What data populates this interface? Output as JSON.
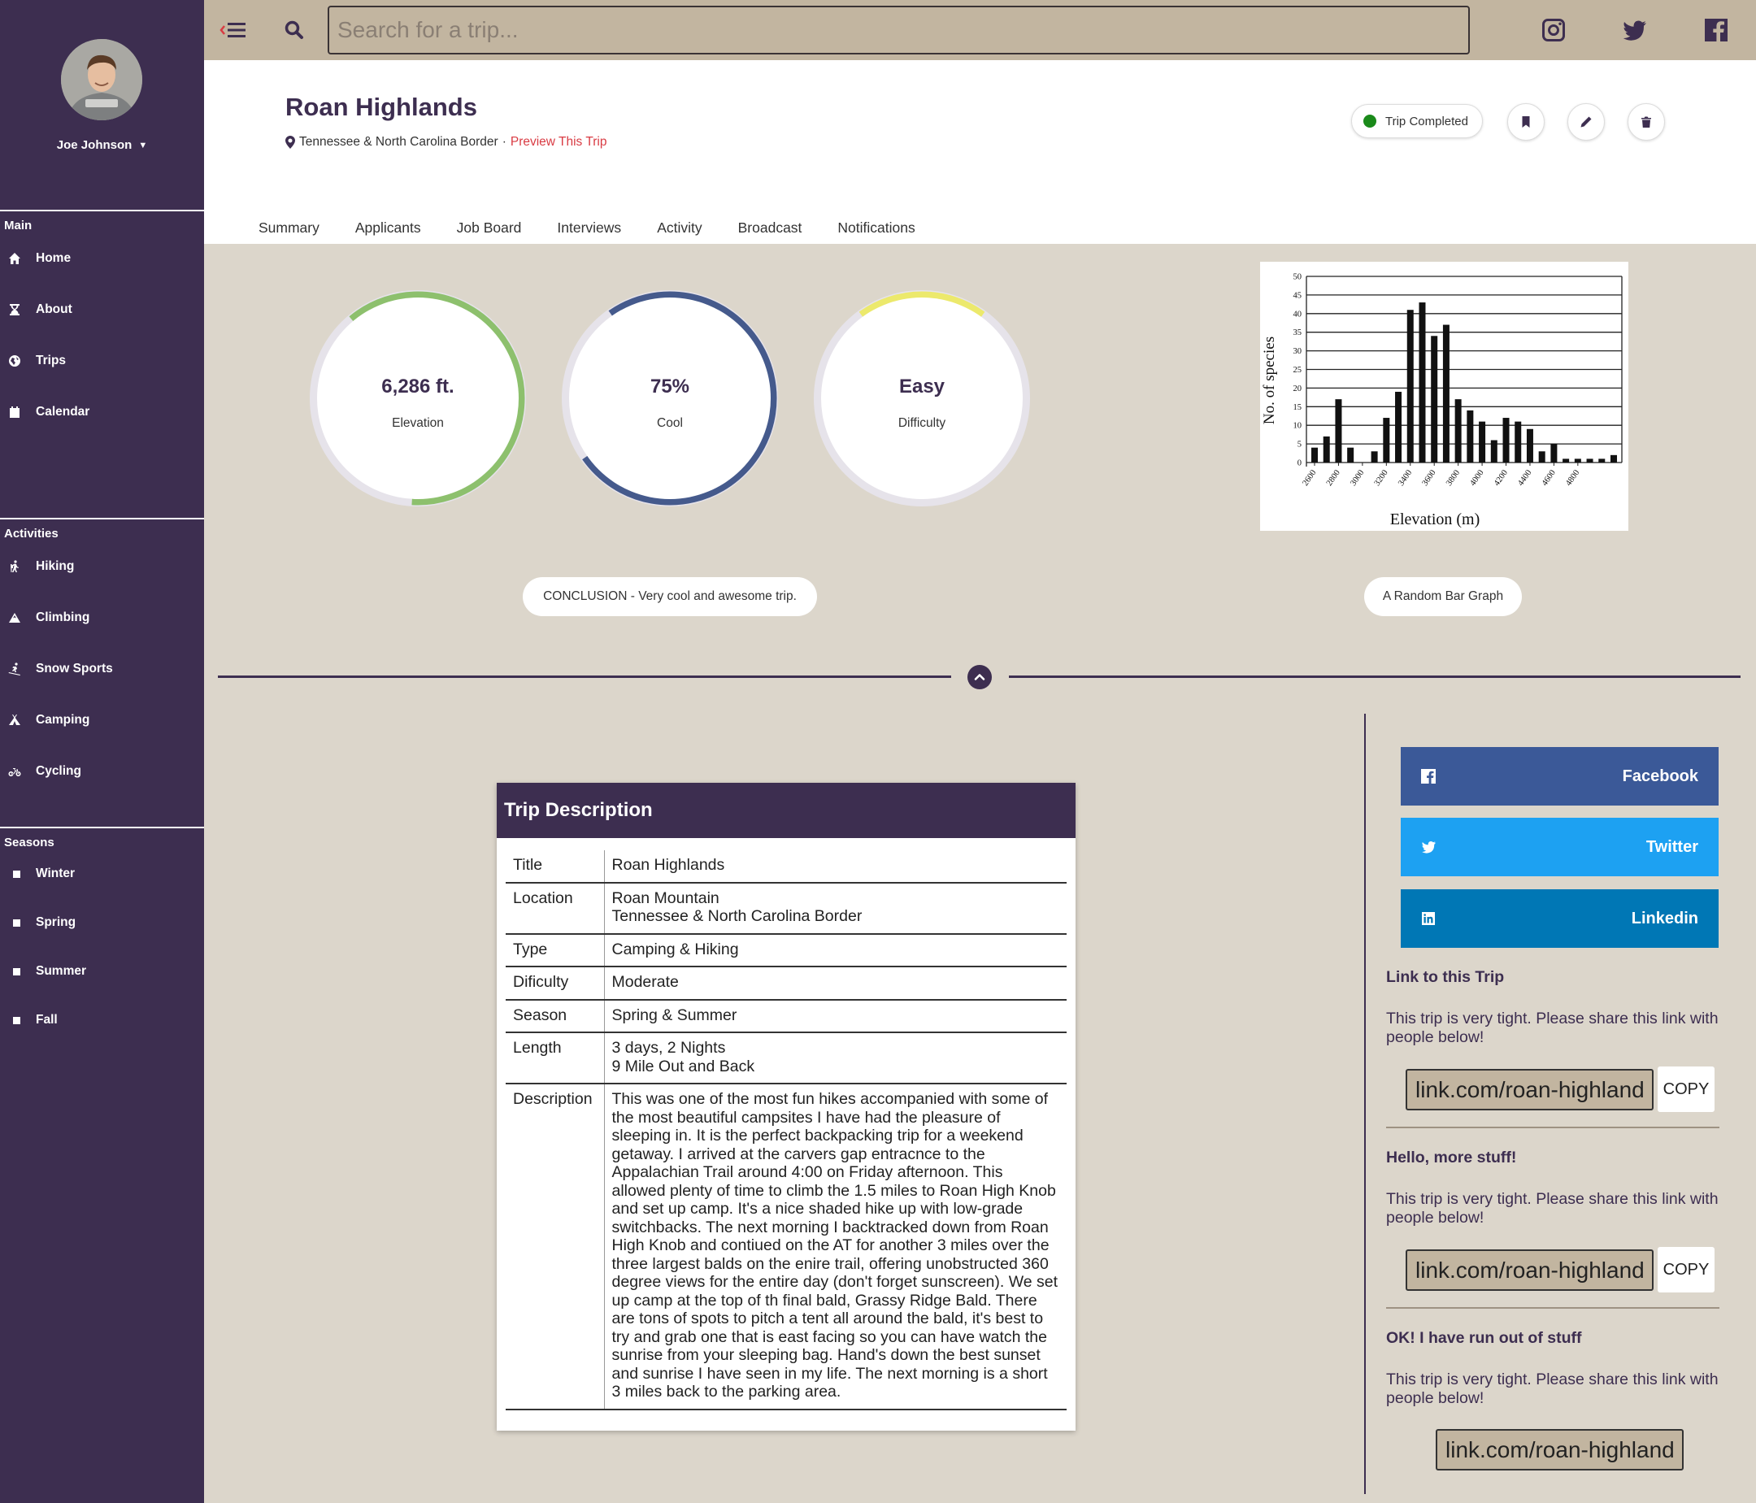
{
  "user": {
    "name": "Joe Johnson"
  },
  "sidebar": {
    "sections": [
      {
        "title": "Main",
        "items": [
          {
            "label": "Home",
            "icon": "home-icon"
          },
          {
            "label": "About",
            "icon": "hourglass-icon"
          },
          {
            "label": "Trips",
            "icon": "globe-icon"
          },
          {
            "label": "Calendar",
            "icon": "calendar-icon"
          }
        ]
      },
      {
        "title": "Activities",
        "items": [
          {
            "label": "Hiking",
            "icon": "hiking-icon"
          },
          {
            "label": "Climbing",
            "icon": "mountain-icon"
          },
          {
            "label": "Snow Sports",
            "icon": "skiing-icon"
          },
          {
            "label": "Camping",
            "icon": "tent-icon"
          },
          {
            "label": "Cycling",
            "icon": "bicycle-icon"
          }
        ]
      },
      {
        "title": "Seasons",
        "items": [
          {
            "label": "Winter",
            "icon": "square-bullet-icon"
          },
          {
            "label": "Spring",
            "icon": "square-bullet-icon"
          },
          {
            "label": "Summer",
            "icon": "square-bullet-icon"
          },
          {
            "label": "Fall",
            "icon": "square-bullet-icon"
          }
        ]
      }
    ]
  },
  "topbar": {
    "search_placeholder": "Search for a trip...",
    "social": [
      "instagram-icon",
      "twitter-icon",
      "facebook-icon"
    ]
  },
  "trip": {
    "title": "Roan Highlands",
    "location": "Tennessee & North Carolina Border",
    "separator": "·",
    "preview_link": "Preview This Trip",
    "status": "Trip Completed",
    "status_color": "#1a8a1a"
  },
  "tabs": [
    "Summary",
    "Applicants",
    "Job Board",
    "Interviews",
    "Activity",
    "Broadcast",
    "Notifications"
  ],
  "stats": [
    {
      "value": "6,286 ft.",
      "caption": "Elevation",
      "color": "#8dc06d",
      "progress": 0.62
    },
    {
      "value": "75%",
      "caption": "Cool",
      "color": "#455a8c",
      "progress": 0.75
    },
    {
      "value": "Easy",
      "caption": "Difficulty",
      "color": "#ece96c",
      "progress": 0.2
    }
  ],
  "conclusion": "CONCLUSION - Very cool and awesome trip.",
  "chart_caption": "A Random Bar Graph",
  "chart_data": {
    "type": "bar",
    "xlabel": "Elevation (m)",
    "ylabel": "No. of species",
    "ylim": [
      0,
      50
    ],
    "yticks": [
      0,
      5,
      10,
      15,
      20,
      25,
      30,
      35,
      40,
      45,
      50
    ],
    "xtick_labels": [
      "2600",
      "2800",
      "3000",
      "3200",
      "3400",
      "3600",
      "3800",
      "4000",
      "4200",
      "4400",
      "4600",
      "4800"
    ],
    "grid": true,
    "x": [
      2600,
      2700,
      2800,
      2900,
      3000,
      3100,
      3200,
      3300,
      3400,
      3500,
      3600,
      3700,
      3800,
      3900,
      4000,
      4100,
      4200,
      4300,
      4400,
      4500,
      4600,
      4700,
      4800,
      4900,
      5000,
      5100
    ],
    "values": [
      4,
      7,
      17,
      4,
      0,
      3,
      12,
      19,
      41,
      43,
      34,
      37,
      17,
      14,
      11,
      6,
      12,
      11,
      9,
      3,
      5,
      1,
      1,
      1,
      1,
      2
    ]
  },
  "description": {
    "header": "Trip Description",
    "rows": [
      {
        "key": "Title",
        "lines": [
          "Roan Highlands"
        ]
      },
      {
        "key": "Location",
        "lines": [
          "Roan Mountain",
          "Tennessee & North Carolina Border"
        ]
      },
      {
        "key": "Type",
        "lines": [
          "Camping & Hiking"
        ]
      },
      {
        "key": "Dificulty",
        "lines": [
          "Moderate"
        ]
      },
      {
        "key": "Season",
        "lines": [
          "Spring & Summer"
        ]
      },
      {
        "key": "Length",
        "lines": [
          "3 days, 2 Nights",
          "9 Mile Out and Back"
        ]
      },
      {
        "key": "Description",
        "lines": [
          "This was one of the most fun hikes accompanied with some of the most beautiful campsites I have had the pleasure of sleeping in. It is the perfect backpacking trip for a weekend getaway. I arrived at the carvers gap entracnce to the Appalachian Trail around 4:00 on Friday afternoon. This allowed plenty of time to climb the 1.5 miles to Roan High Knob and set up camp. It's a nice shaded hike up with low-grade switchbacks. The next morning I backtracked down from Roan High Knob and contiued on the AT for another 3 miles over the three largest balds on the enire trail, offering unobstructed 360 degree views for the entire day (don't forget sunscreen). We set up camp at the top of th final bald, Grassy Ridge Bald. There are tons of spots to pitch a tent all around the bald, it's best to try and grab one that is east facing so you can have watch the sunrise from your sleeping bag. Hand's down the best sunset and sunrise I have seen in my life. The next morning is a short 3 miles back to the parking area."
        ]
      }
    ]
  },
  "share": {
    "buttons": [
      {
        "label": "Facebook",
        "icon": "facebook-icon",
        "color": "#3b5998"
      },
      {
        "label": "Twitter",
        "icon": "twitter-icon",
        "color": "#1da1f2"
      },
      {
        "label": "Linkedin",
        "icon": "linkedin-icon",
        "color": "#0077b5"
      }
    ],
    "sections": [
      {
        "heading": "Link to this Trip",
        "text": "This trip is very tight. Please share this link with people below!",
        "link": "link.com/roan-highland",
        "copy": "COPY"
      },
      {
        "heading": "Hello, more stuff!",
        "text": "This trip is very tight. Please share this link with people below!",
        "link": "link.com/roan-highland",
        "copy": "COPY"
      },
      {
        "heading": "OK! I have run out of stuff",
        "text": "This trip is very tight. Please share this link with people below!",
        "link": "link.com/roan-highland"
      }
    ]
  }
}
